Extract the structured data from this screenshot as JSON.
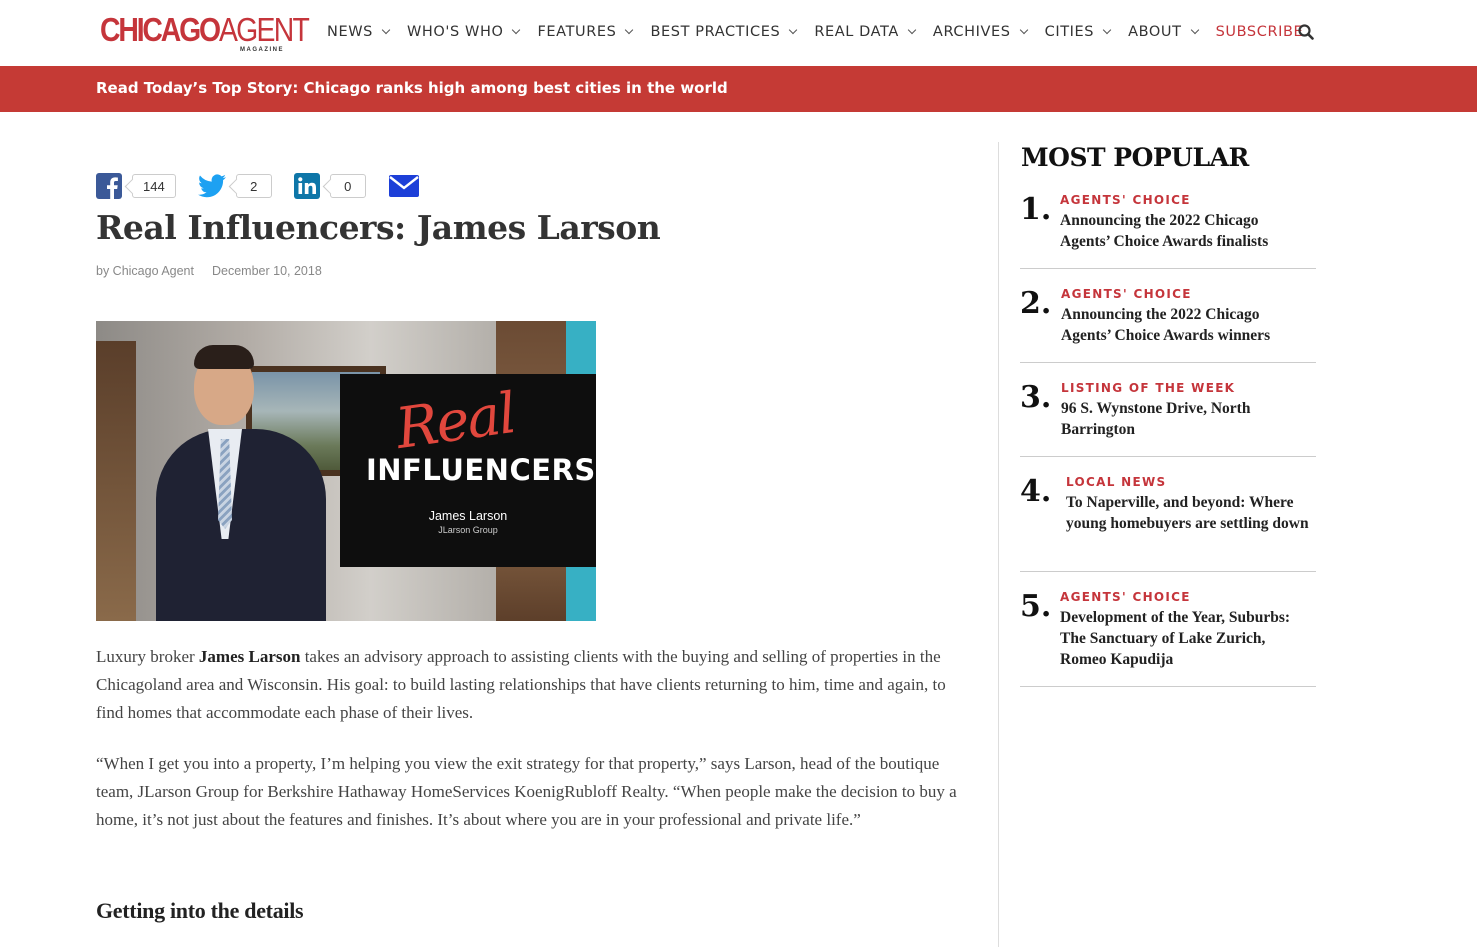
{
  "header": {
    "logo_main": "CHICAGO",
    "logo_agent": "AGENT",
    "logo_sub": "MAGAZINE",
    "nav": [
      {
        "label": "NEWS"
      },
      {
        "label": "WHO'S WHO"
      },
      {
        "label": "FEATURES"
      },
      {
        "label": "BEST PRACTICES"
      },
      {
        "label": "REAL DATA"
      },
      {
        "label": "ARCHIVES"
      },
      {
        "label": "CITIES"
      },
      {
        "label": "ABOUT"
      }
    ],
    "subscribe": "SUBSCRIBE",
    "search_icon": "search-icon"
  },
  "banner": {
    "text": "Read Today’s Top Story: Chicago ranks high among best cities in the world"
  },
  "share": {
    "facebook": "144",
    "twitter": "2",
    "linkedin": "0"
  },
  "article": {
    "title": "Real Influencers: James Larson",
    "author": "by Chicago Agent",
    "date": "December 10, 2018",
    "hero": {
      "real": "Real",
      "influencers": "INFLUENCERS",
      "name": "James Larson",
      "group": "JLarson Group"
    },
    "p1_pre": "Luxury broker ",
    "p1_bold": "James Larson",
    "p1_post": " takes an advisory approach to assisting clients with the buying and selling of properties in the Chicagoland area and Wisconsin. His goal: to build lasting relationships that have clients returning to him, time and again, to find homes that accommodate each phase of their lives.",
    "p2": "“When I get you into a property, I’m helping you view the exit strategy for that property,” says Larson, head of the boutique team, JLarson Group for Berkshire Hathaway HomeServices KoenigRubloff Realty. “When people make the decision to buy a home, it’s not just about the features and finishes. It’s about where you are in your professional and private life.”",
    "subhead": "Getting into the details"
  },
  "sidebar": {
    "title": "MOST POPULAR",
    "items": [
      {
        "num": "1.",
        "category": "AGENTS' CHOICE",
        "title": "Announcing the 2022 Chicago Agents’ Choice Awards finalists"
      },
      {
        "num": "2.",
        "category": "AGENTS' CHOICE",
        "title": "Announcing the 2022 Chicago Agents’ Choice Awards winners"
      },
      {
        "num": "3.",
        "category": "LISTING OF THE WEEK",
        "title": "96 S. Wynstone Drive, North Barrington"
      },
      {
        "num": "4.",
        "category": "LOCAL NEWS",
        "title": "To Naperville, and beyond: Where young homebuyers are settling down"
      },
      {
        "num": "5.",
        "category": "AGENTS' CHOICE",
        "title": "Development of the Year, Suburbs: The Sanctuary of Lake Zurich, Romeo Kapudija"
      }
    ]
  }
}
